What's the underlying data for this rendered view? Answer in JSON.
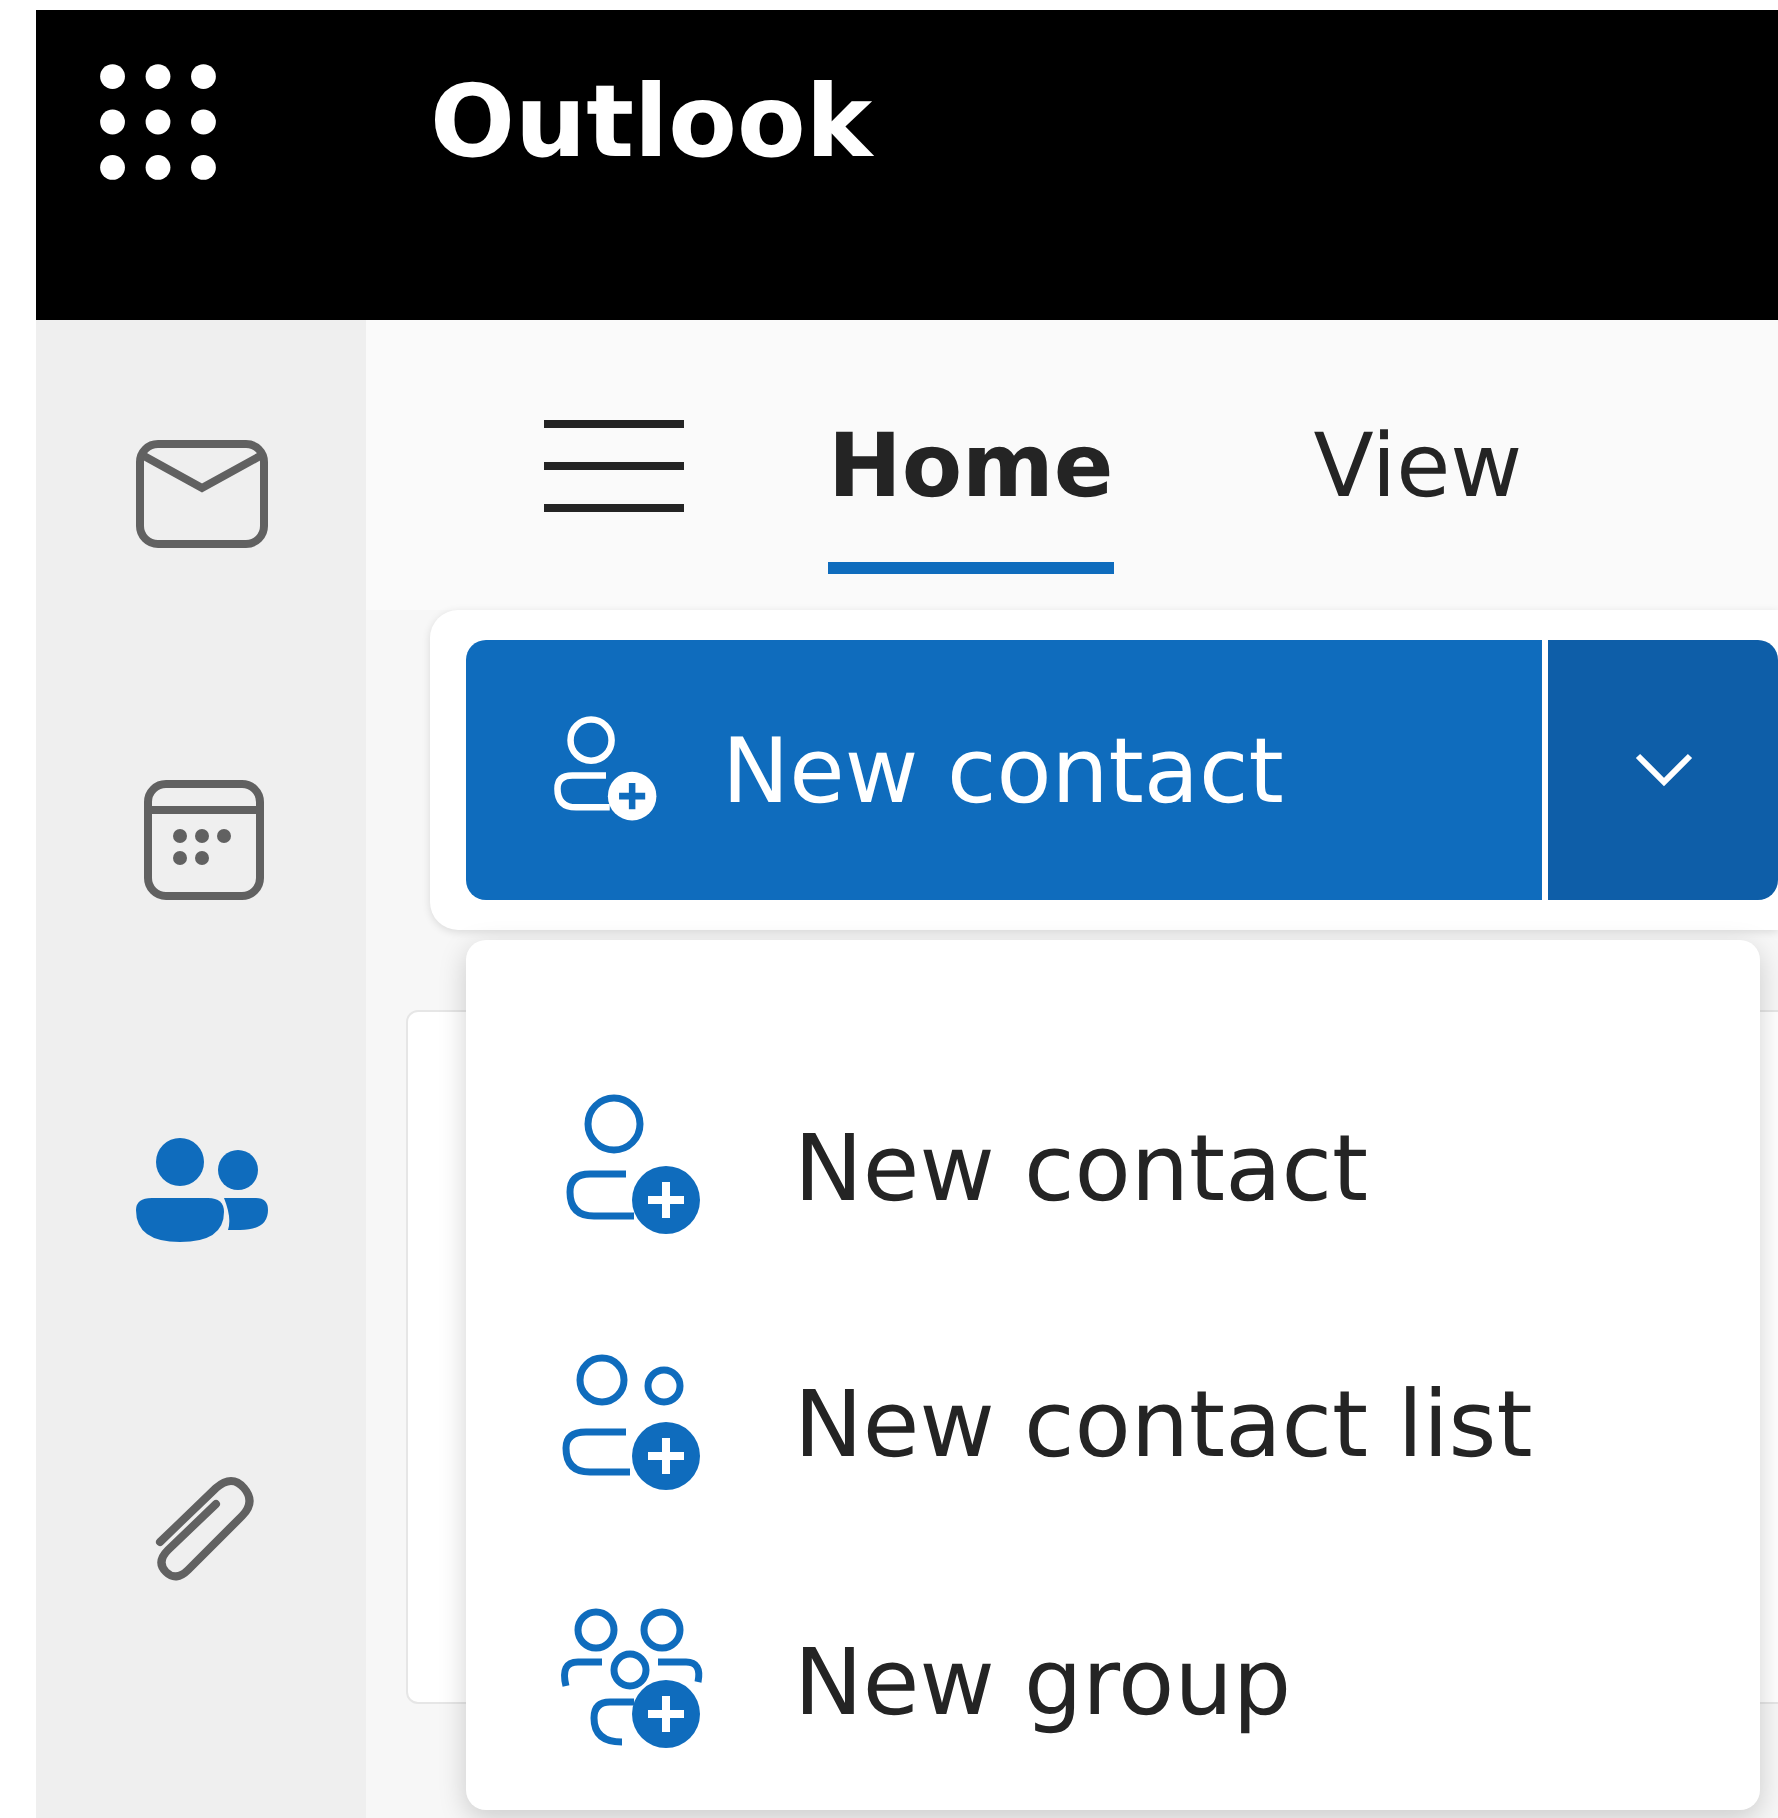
{
  "header": {
    "title": "Outlook"
  },
  "rail": [
    {
      "kind": "mail",
      "selected": false
    },
    {
      "kind": "calendar",
      "selected": false
    },
    {
      "kind": "people",
      "selected": true
    },
    {
      "kind": "files",
      "selected": false
    }
  ],
  "tabs": [
    {
      "label": "Home",
      "selected": true
    },
    {
      "label": "View",
      "selected": false
    }
  ],
  "split_button": {
    "label": "New contact"
  },
  "menu": [
    {
      "kind": "contact",
      "label": "New contact"
    },
    {
      "kind": "list",
      "label": "New contact list"
    },
    {
      "kind": "group",
      "label": "New group"
    }
  ]
}
